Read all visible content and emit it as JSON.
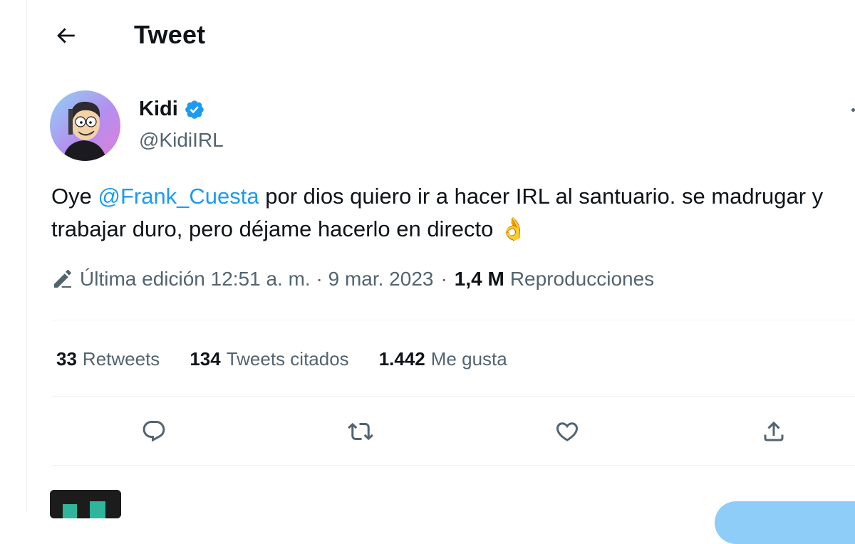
{
  "header": {
    "title": "Tweet",
    "back_icon": "arrow-left-icon"
  },
  "author": {
    "name": "Kidi",
    "handle": "@KidiIRL",
    "verified_icon": "verified-badge-icon",
    "verified_color": "#1d9bf0"
  },
  "tweet": {
    "text_before": "Oye ",
    "mention": "@Frank_Cuesta",
    "text_after": " por dios quiero ir a hacer IRL al santuario. se madrugar y trabajar duro, pero déjame hacerlo en directo ",
    "emoji": "👌"
  },
  "meta": {
    "edit_icon": "pencil-icon",
    "edited_label": "Última edición 12:51 a. m. · 9 mar. 2023",
    "separator": "·",
    "views_count": "1,4 M",
    "views_label": "Reproducciones"
  },
  "stats": {
    "retweets_count": "33",
    "retweets_label": "Retweets",
    "quotes_count": "134",
    "quotes_label": "Tweets citados",
    "likes_count": "1.442",
    "likes_label": "Me gusta"
  },
  "actions": [
    "reply-icon",
    "retweet-icon",
    "like-icon",
    "share-icon"
  ],
  "colors": {
    "accent": "#1d9bf0",
    "text": "#0f1419",
    "secondary": "#536471",
    "border": "#eff3f4"
  }
}
